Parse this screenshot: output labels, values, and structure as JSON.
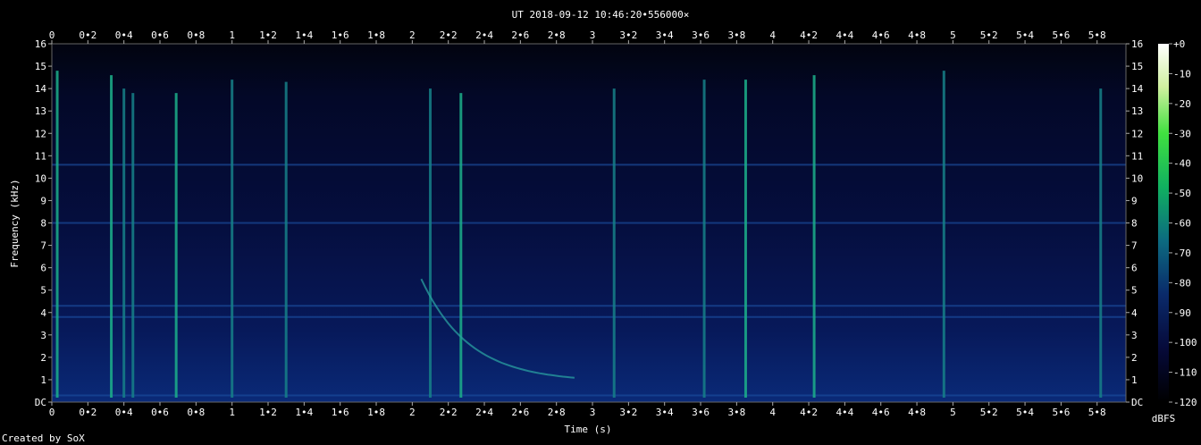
{
  "chart_data": {
    "type": "heatmap",
    "title": "UT 2018-09-12 10:46:20•556000×",
    "xlabel": "Time (s)",
    "ylabel": "Frequency (kHz)",
    "x_unit": "s",
    "y_unit": "kHz",
    "xlim": [
      0,
      5.96
    ],
    "ylim": [
      0,
      16
    ],
    "x_ticks": [
      "0",
      "0•2",
      "0•4",
      "0•6",
      "0•8",
      "1",
      "1•2",
      "1•4",
      "1•6",
      "1•8",
      "2",
      "2•2",
      "2•4",
      "2•6",
      "2•8",
      "3",
      "3•2",
      "3•4",
      "3•6",
      "3•8",
      "4",
      "4•2",
      "4•4",
      "4•6",
      "4•8",
      "5",
      "5•2",
      "5•4",
      "5•6",
      "5•8"
    ],
    "y_ticks": [
      "DC",
      "1",
      "2",
      "3",
      "4",
      "5",
      "6",
      "7",
      "8",
      "9",
      "10",
      "11",
      "12",
      "13",
      "14",
      "15",
      "16"
    ],
    "colorbar": {
      "label": "dBFS",
      "range": [
        -120,
        0
      ],
      "ticks": [
        "+0",
        "-10",
        "-20",
        "-30",
        "-40",
        "-50",
        "-60",
        "-70",
        "-80",
        "-90",
        "-100",
        "-110",
        "-120"
      ]
    },
    "impulses": [
      {
        "t": 0.03,
        "fmax": 14.8,
        "level": -70
      },
      {
        "t": 0.33,
        "fmax": 14.6,
        "level": -62
      },
      {
        "t": 0.4,
        "fmax": 14.0,
        "level": -80
      },
      {
        "t": 0.45,
        "fmax": 13.8,
        "level": -78
      },
      {
        "t": 0.69,
        "fmax": 13.8,
        "level": -65
      },
      {
        "t": 1.0,
        "fmax": 14.4,
        "level": -75
      },
      {
        "t": 1.3,
        "fmax": 14.3,
        "level": -80
      },
      {
        "t": 2.1,
        "fmax": 14.0,
        "level": -72
      },
      {
        "t": 2.27,
        "fmax": 13.8,
        "level": -60
      },
      {
        "t": 3.12,
        "fmax": 14.0,
        "level": -78
      },
      {
        "t": 3.62,
        "fmax": 14.4,
        "level": -75
      },
      {
        "t": 3.85,
        "fmax": 14.4,
        "level": -68
      },
      {
        "t": 4.23,
        "fmax": 14.6,
        "level": -65
      },
      {
        "t": 4.95,
        "fmax": 14.8,
        "level": -72
      },
      {
        "t": 5.82,
        "fmax": 14.0,
        "level": -78
      }
    ],
    "chirp": {
      "t_start": 2.05,
      "t_end": 2.9,
      "f_start": 5.5,
      "f_end": 0.9,
      "level": -80
    },
    "hum_lines_khz": [
      0.3,
      3.8,
      4.3,
      8.0,
      10.6
    ],
    "footer": "Created by SoX"
  }
}
